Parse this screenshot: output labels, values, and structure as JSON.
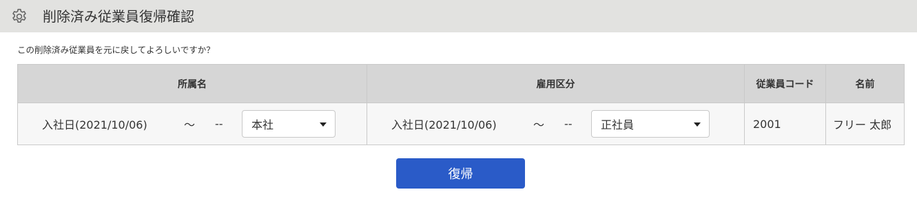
{
  "header": {
    "title": "削除済み従業員復帰確認",
    "icon": "gear-icon"
  },
  "message": "この削除済み従業員を元に戻してよろしいですか？",
  "table": {
    "columns": [
      "所属名",
      "雇用区分",
      "従業員コード",
      "名前"
    ],
    "row": {
      "department": {
        "date": "入社日(2021/10/06)",
        "tilde": "～",
        "end": "--",
        "selected": "本社"
      },
      "employment": {
        "date": "入社日(2021/10/06)",
        "tilde": "～",
        "end": "--",
        "selected": "正社員"
      },
      "code": "2001",
      "name": "フリー 太郎"
    }
  },
  "restore_button": {
    "label": "復帰",
    "color": "#2a5bc8"
  }
}
